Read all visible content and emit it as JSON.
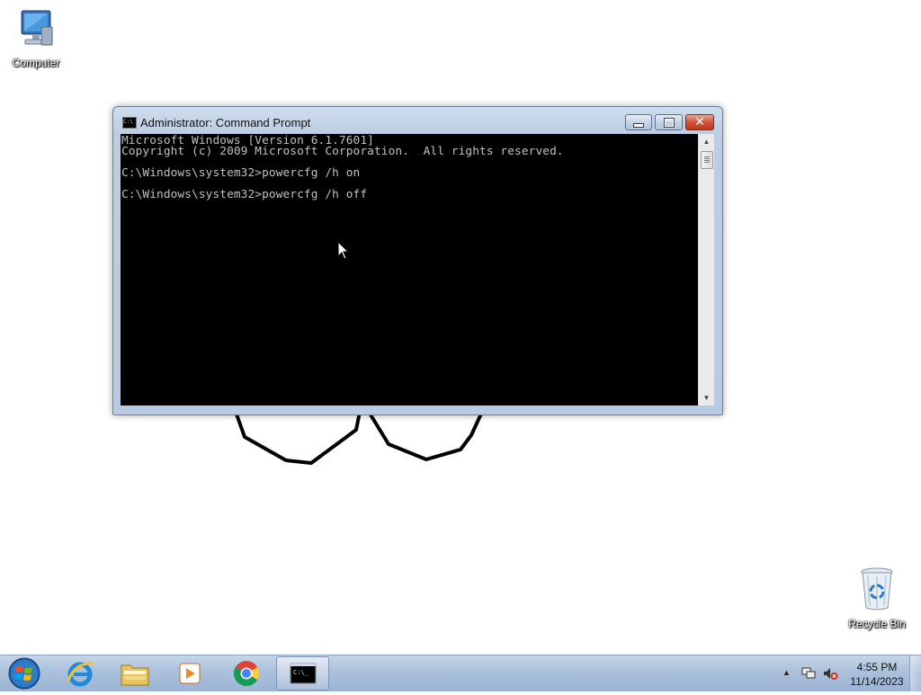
{
  "desktop": {
    "icons": [
      {
        "label": "Computer",
        "icon": "computer-icon"
      },
      {
        "label": "Recycle Bin",
        "icon": "recycle-bin-icon"
      }
    ]
  },
  "window": {
    "title": "Administrator: Command Prompt",
    "title_icon": "cmd-icon",
    "buttons": {
      "minimize": "minimize-icon",
      "maximize": "maximize-icon",
      "close": "close-icon"
    },
    "close_color": "#c7452b"
  },
  "console": {
    "lines": [
      "Microsoft Windows [Version 6.1.7601]",
      "Copyright (c) 2009 Microsoft Corporation.  All rights reserved.",
      "",
      "C:\\Windows\\system32>powercfg /h on",
      "",
      "C:\\Windows\\system32>powercfg /h off"
    ],
    "background": "#000000",
    "foreground": "#c0c0c0"
  },
  "taskbar": {
    "items": [
      {
        "name": "start",
        "icon": "windows-start-icon"
      },
      {
        "name": "internet-explorer",
        "icon": "ie-icon"
      },
      {
        "name": "windows-explorer",
        "icon": "folder-icon"
      },
      {
        "name": "media-player",
        "icon": "media-player-icon"
      },
      {
        "name": "chrome",
        "icon": "chrome-icon"
      },
      {
        "name": "command-prompt",
        "icon": "cmd-icon",
        "active": true
      }
    ],
    "tray": {
      "icons": [
        "show-hidden-icons-arrow",
        "network-icon",
        "volume-muted-icon"
      ],
      "time": "4:55 PM",
      "date": "11/14/2023"
    }
  }
}
